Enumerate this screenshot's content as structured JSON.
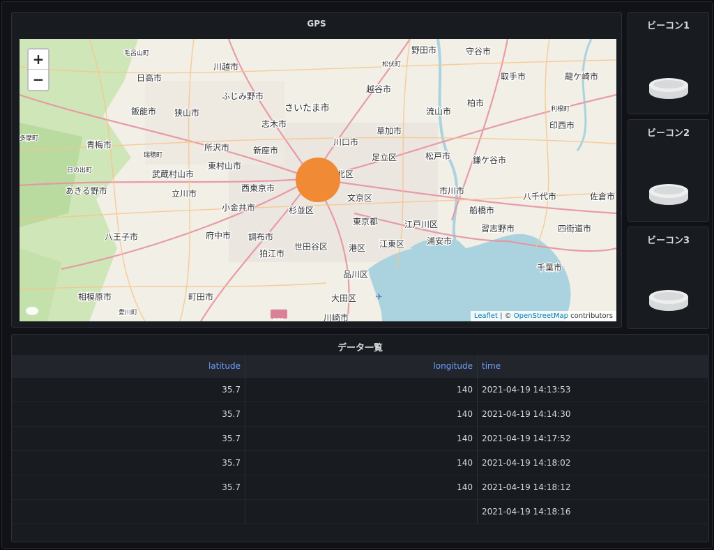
{
  "gps_panel": {
    "title": "GPS",
    "zoom_in": "+",
    "zoom_out": "−",
    "attribution": {
      "leaflet": "Leaflet",
      "sep": " | © ",
      "osm": "OpenStreetMap",
      "suffix": " contributors"
    },
    "marker_color": "#f08a35",
    "map_labels": [
      "毛呂山町",
      "日高市",
      "川越市",
      "野田市",
      "守谷市",
      "松伏町",
      "龍ケ崎市",
      "取手市",
      "ふじみ野市",
      "越谷市",
      "飯能市",
      "狭山市",
      "さいたま市",
      "流山市",
      "柏市",
      "利根町",
      "志木市",
      "草加市",
      "印西市",
      "青梅市",
      "所沢市",
      "新座市",
      "川口市",
      "多摩町",
      "瑞穂町",
      "東村山市",
      "足立区",
      "松戸市",
      "鎌ケ谷市",
      "武蔵村山市",
      "北区",
      "日の出町",
      "西東京市",
      "あきる野市",
      "立川市",
      "文京区",
      "市川市",
      "八千代市",
      "佐倉市",
      "小金井市",
      "杉並区",
      "東京都",
      "船橋市",
      "江戸川区",
      "習志野市",
      "四街道市",
      "八王子市",
      "府中市",
      "調布市",
      "世田谷区",
      "港区",
      "江東区",
      "浦安市",
      "狛江市",
      "千葉市",
      "品川区",
      "相模原市",
      "町田市",
      "大田区",
      "愛川町",
      "川崎市",
      "E83"
    ]
  },
  "beacons": [
    {
      "title": "ビーコン1"
    },
    {
      "title": "ビーコン2"
    },
    {
      "title": "ビーコン3"
    }
  ],
  "table_panel": {
    "title": "データ一覧",
    "columns": [
      "latitude",
      "longitude",
      "time"
    ],
    "rows": [
      [
        "35.7",
        "140",
        "2021-04-19 14:13:53"
      ],
      [
        "35.7",
        "140",
        "2021-04-19 14:14:30"
      ],
      [
        "35.7",
        "140",
        "2021-04-19 14:17:52"
      ],
      [
        "35.7",
        "140",
        "2021-04-19 14:18:02"
      ],
      [
        "35.7",
        "140",
        "2021-04-19 14:18:12"
      ],
      [
        "",
        "",
        "2021-04-19 14:18:16"
      ]
    ]
  }
}
